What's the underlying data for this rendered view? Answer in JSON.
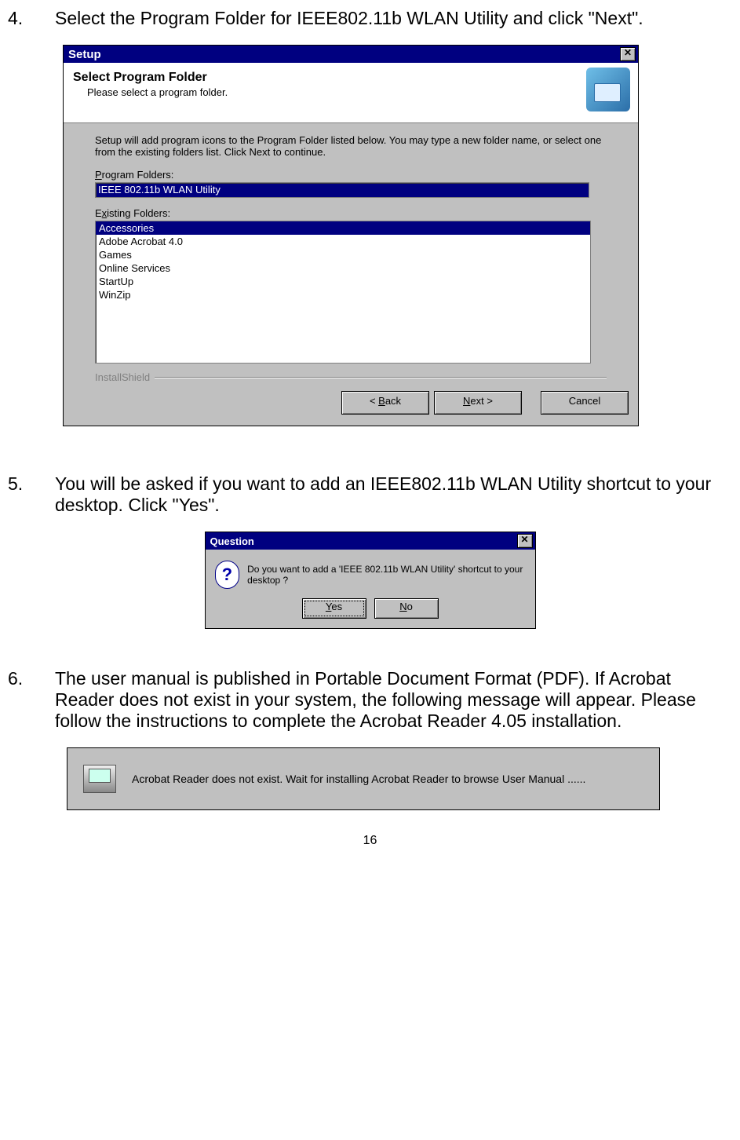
{
  "steps": {
    "s4": {
      "num": "4.",
      "text": "Select the Program Folder for IEEE802.11b WLAN Utility and click \"Next\"."
    },
    "s5": {
      "num": "5.",
      "text": "You will be asked if you want to add an IEEE802.11b WLAN Utility shortcut to your desktop. Click \"Yes\"."
    },
    "s6": {
      "num": "6.",
      "text": "The user manual is published in Portable Document Format (PDF). If Acrobat Reader does not exist in your system, the following message will appear. Please follow the instructions to complete the Acrobat Reader 4.05 installation."
    }
  },
  "setup": {
    "title": "Setup",
    "header_bold": "Select Program Folder",
    "header_sub": "Please select a program folder.",
    "intro": "Setup will add program icons to the Program Folder listed below.  You may type a new folder name, or select one from the existing folders list.  Click Next to continue.",
    "label_program_folders_prefix": "P",
    "label_program_folders_rest": "rogram Folders:",
    "program_folder_value": "IEEE 802.11b WLAN Utility",
    "label_existing_prefix": "E",
    "label_existing_u": "x",
    "label_existing_rest": "isting Folders:",
    "existing": [
      "Accessories",
      "Adobe Acrobat 4.0",
      "Games",
      "Online Services",
      "StartUp",
      "WinZip"
    ],
    "installshield": "InstallShield",
    "btn_back_prefix": "< ",
    "btn_back_u": "B",
    "btn_back_rest": "ack",
    "btn_next_u": "N",
    "btn_next_rest": "ext >",
    "btn_cancel": "Cancel"
  },
  "question": {
    "title": "Question",
    "icon": "?",
    "text": "Do you want to add a 'IEEE 802.11b WLAN Utility' shortcut to your desktop ?",
    "btn_yes_u": "Y",
    "btn_yes_rest": "es",
    "btn_no_u": "N",
    "btn_no_rest": "o"
  },
  "info": {
    "text": "Acrobat Reader does not exist. Wait for installing Acrobat Reader to browse User Manual ......"
  },
  "page_number": "16"
}
